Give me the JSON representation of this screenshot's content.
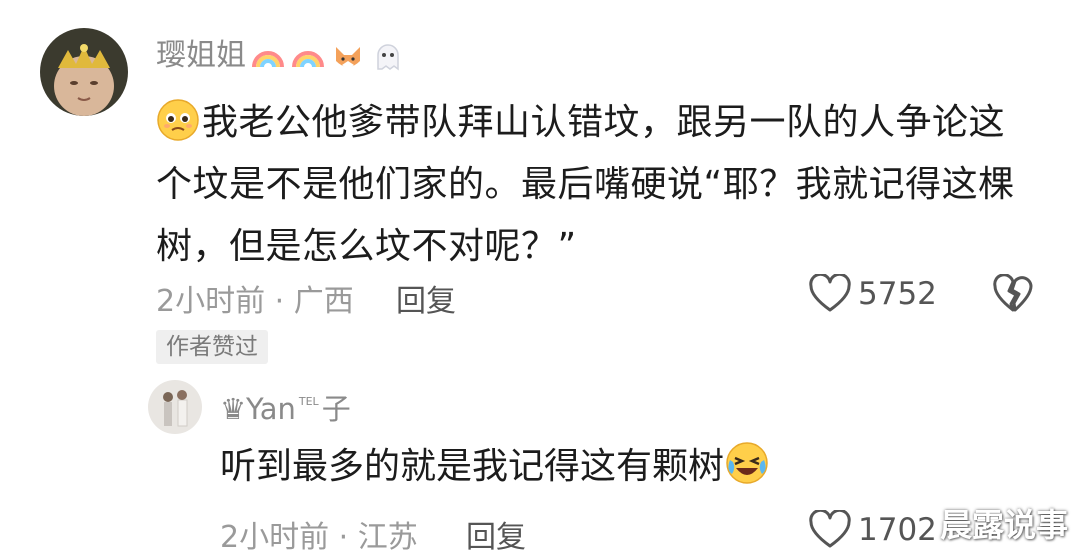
{
  "comment": {
    "username": "璎姐姐",
    "username_badges": [
      "rainbow-icon",
      "rainbow-icon",
      "fox-icon",
      "ghost-icon"
    ],
    "leading_emoji": "pleading-face-icon",
    "text": "我老公他爹带队拜山认错坟，跟另一队的人争论这个坟是不是他们家的。最后嘴硬说“耶？我就记得这棵树，但是怎么坟不对呢？”",
    "time": "2小时前",
    "location": "广西",
    "meta_separator": " · ",
    "reply_label": "回复",
    "like_count": "5752",
    "author_liked_label": "作者赞过"
  },
  "reply": {
    "username_prefix": "♛Yan",
    "username_sup": "TEL",
    "username_suffix": "子",
    "text": "听到最多的就是我记得这有颗树",
    "trailing_emoji": "laughing-crying-face-icon",
    "time": "2小时前",
    "location": "江苏",
    "meta_separator": " · ",
    "reply_label": "回复",
    "like_count": "1702"
  },
  "watermark": "晨露说事"
}
